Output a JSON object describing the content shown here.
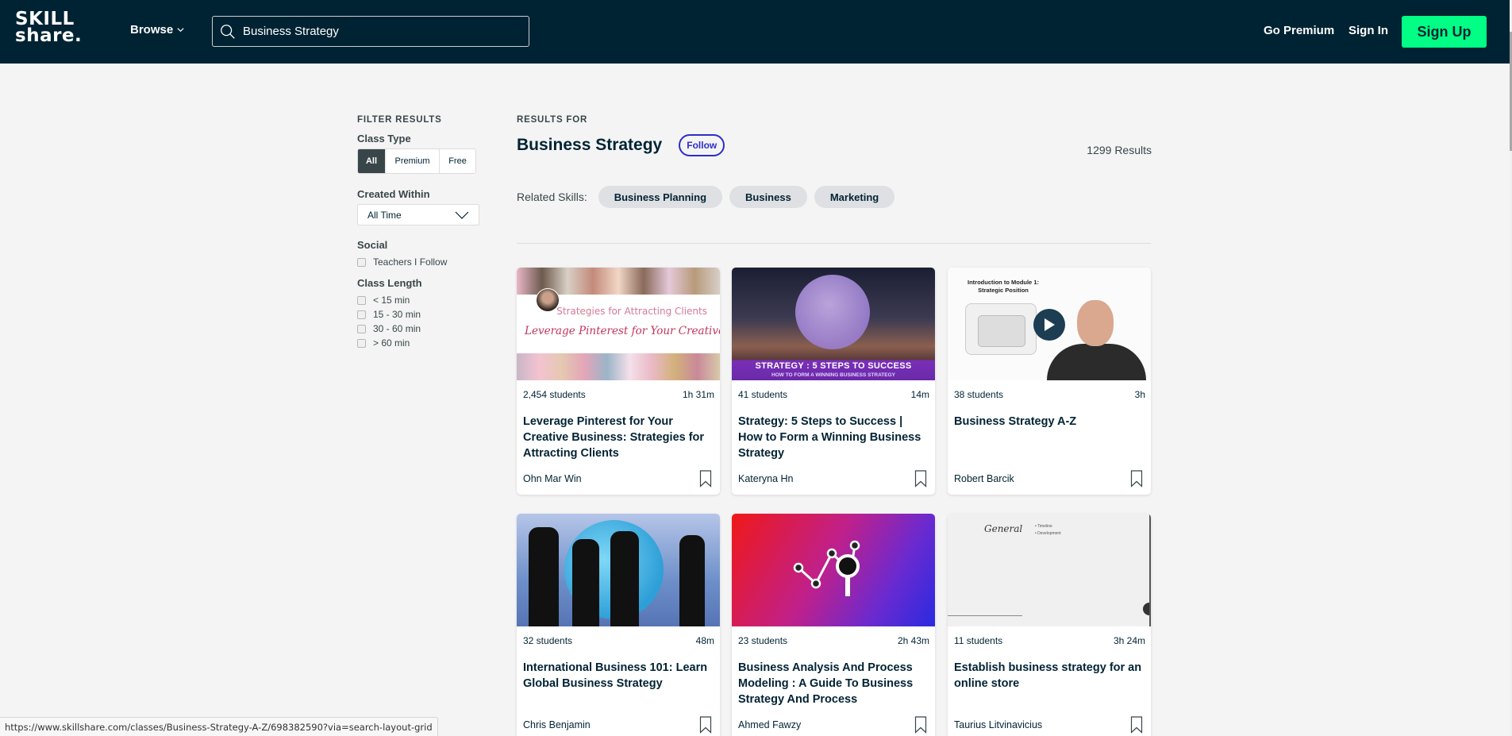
{
  "header": {
    "logo_line1": "SKILL",
    "logo_line2": "share.",
    "browse_label": "Browse",
    "search_value": "Business Strategy",
    "go_premium_label": "Go Premium",
    "sign_in_label": "Sign In",
    "sign_up_label": "Sign Up",
    "colors": {
      "header_bg": "#002333",
      "sign_up_bg": "#00ff84"
    }
  },
  "filters": {
    "title": "FILTER RESULTS",
    "class_type": {
      "heading": "Class Type",
      "options": [
        "All",
        "Premium",
        "Free"
      ],
      "selected": "All"
    },
    "created_within": {
      "heading": "Created Within",
      "selected": "All Time"
    },
    "social": {
      "heading": "Social",
      "options": [
        {
          "label": "Teachers I Follow",
          "checked": false
        }
      ]
    },
    "class_length": {
      "heading": "Class Length",
      "options": [
        {
          "label": "< 15 min",
          "checked": false
        },
        {
          "label": "15 - 30 min",
          "checked": false
        },
        {
          "label": "30 - 60 min",
          "checked": false
        },
        {
          "label": "> 60 min",
          "checked": false
        }
      ]
    }
  },
  "results": {
    "results_for_label": "RESULTS FOR",
    "query": "Business Strategy",
    "follow_label": "Follow",
    "count": "1299 Results",
    "related_label": "Related Skills:",
    "related_skills": [
      "Business Planning",
      "Business",
      "Marketing"
    ],
    "follow_color": "#2d2dc8"
  },
  "cards": [
    {
      "students": "2,454 students",
      "duration": "1h 31m",
      "title": "Leverage Pinterest for Your Creative Business: Strategies for Attracting Clients",
      "teacher": "Ohn Mar Win",
      "thumb_sub": "Strategies for Attracting Clients",
      "thumb_main": "Leverage Pinterest for Your Creative Business:"
    },
    {
      "students": "41 students",
      "duration": "14m",
      "title": "Strategy: 5 Steps to Success | How to Form a Winning Business Strategy",
      "teacher": "Kateryna Hn",
      "thumb_line1": "STRATEGY : 5 STEPS TO SUCCESS",
      "thumb_line2": "HOW TO FORM A WINNING BUSINESS STRATEGY"
    },
    {
      "students": "38 students",
      "duration": "3h",
      "title": "Business Strategy A-Z",
      "teacher": "Robert Barcik",
      "thumb_heading_1": "Introduction to Module 1:",
      "thumb_heading_2": "Strategic Position"
    },
    {
      "students": "32 students",
      "duration": "48m",
      "title": "International Business 101: Learn Global Business Strategy",
      "teacher": "Chris Benjamin"
    },
    {
      "students": "23 students",
      "duration": "2h 43m",
      "title": "Business Analysis And Process Modeling : A Guide To Business Strategy And Process",
      "teacher": "Ahmed Fawzy"
    },
    {
      "students": "11 students",
      "duration": "3h 24m",
      "title": "Establish business strategy for an online store",
      "teacher": "Taurius Litvinavicius",
      "thumb_heading": "General",
      "thumb_bullets": [
        "Timeline",
        "Development"
      ]
    }
  ],
  "status_bar": {
    "url": "https://www.skillshare.com/classes/Business-Strategy-A-Z/698382590?via=search-layout-grid"
  }
}
